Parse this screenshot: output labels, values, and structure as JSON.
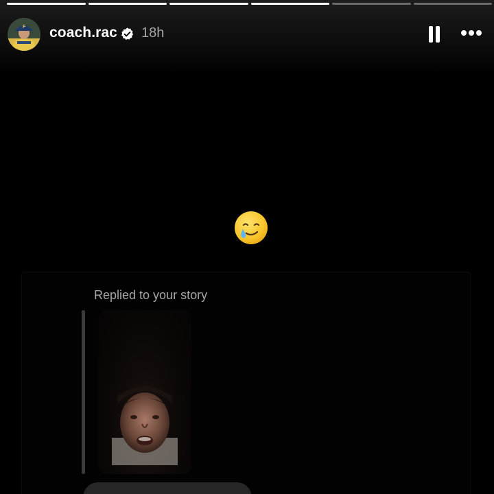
{
  "story": {
    "progress_segments": [
      {
        "fill": 1
      },
      {
        "fill": 1
      },
      {
        "fill": 1
      },
      {
        "fill": 1
      },
      {
        "fill": 0
      },
      {
        "fill": 0
      }
    ]
  },
  "header": {
    "username": "coach.rac",
    "verified": true,
    "timestamp": "18h",
    "avatar_icon": "profile-photo",
    "pause_icon": "pause-icon",
    "more_icon": "more-options-icon"
  },
  "content": {
    "emoji": "🥲",
    "replied_label": "Replied to your story",
    "story_thumbnail_icon": "story-preview-image"
  },
  "colors": {
    "background": "#000000",
    "secondary_text": "#a8a8a8",
    "verified_badge": "#ffffff"
  }
}
